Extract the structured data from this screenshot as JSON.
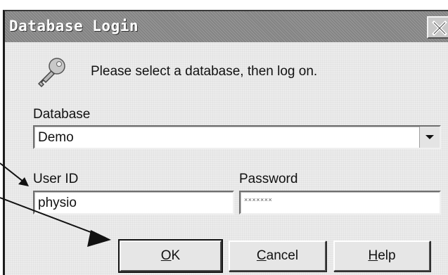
{
  "window": {
    "title": "Database Login",
    "close_icon": "close-icon"
  },
  "header": {
    "icon": "key-icon",
    "instruction": "Please select a database, then log on."
  },
  "database": {
    "label": "Database",
    "selected": "Demo",
    "dropdown_icon": "chevron-down-icon"
  },
  "user_id": {
    "label": "User ID",
    "value": "physio"
  },
  "password": {
    "label": "Password",
    "value": "×××××××"
  },
  "buttons": {
    "ok": {
      "mnemonic": "O",
      "rest": "K"
    },
    "cancel": {
      "mnemonic": "C",
      "rest": "ancel"
    },
    "help": {
      "mnemonic": "H",
      "rest": "elp"
    }
  },
  "annotations": {
    "arrow_color": "#111111"
  }
}
